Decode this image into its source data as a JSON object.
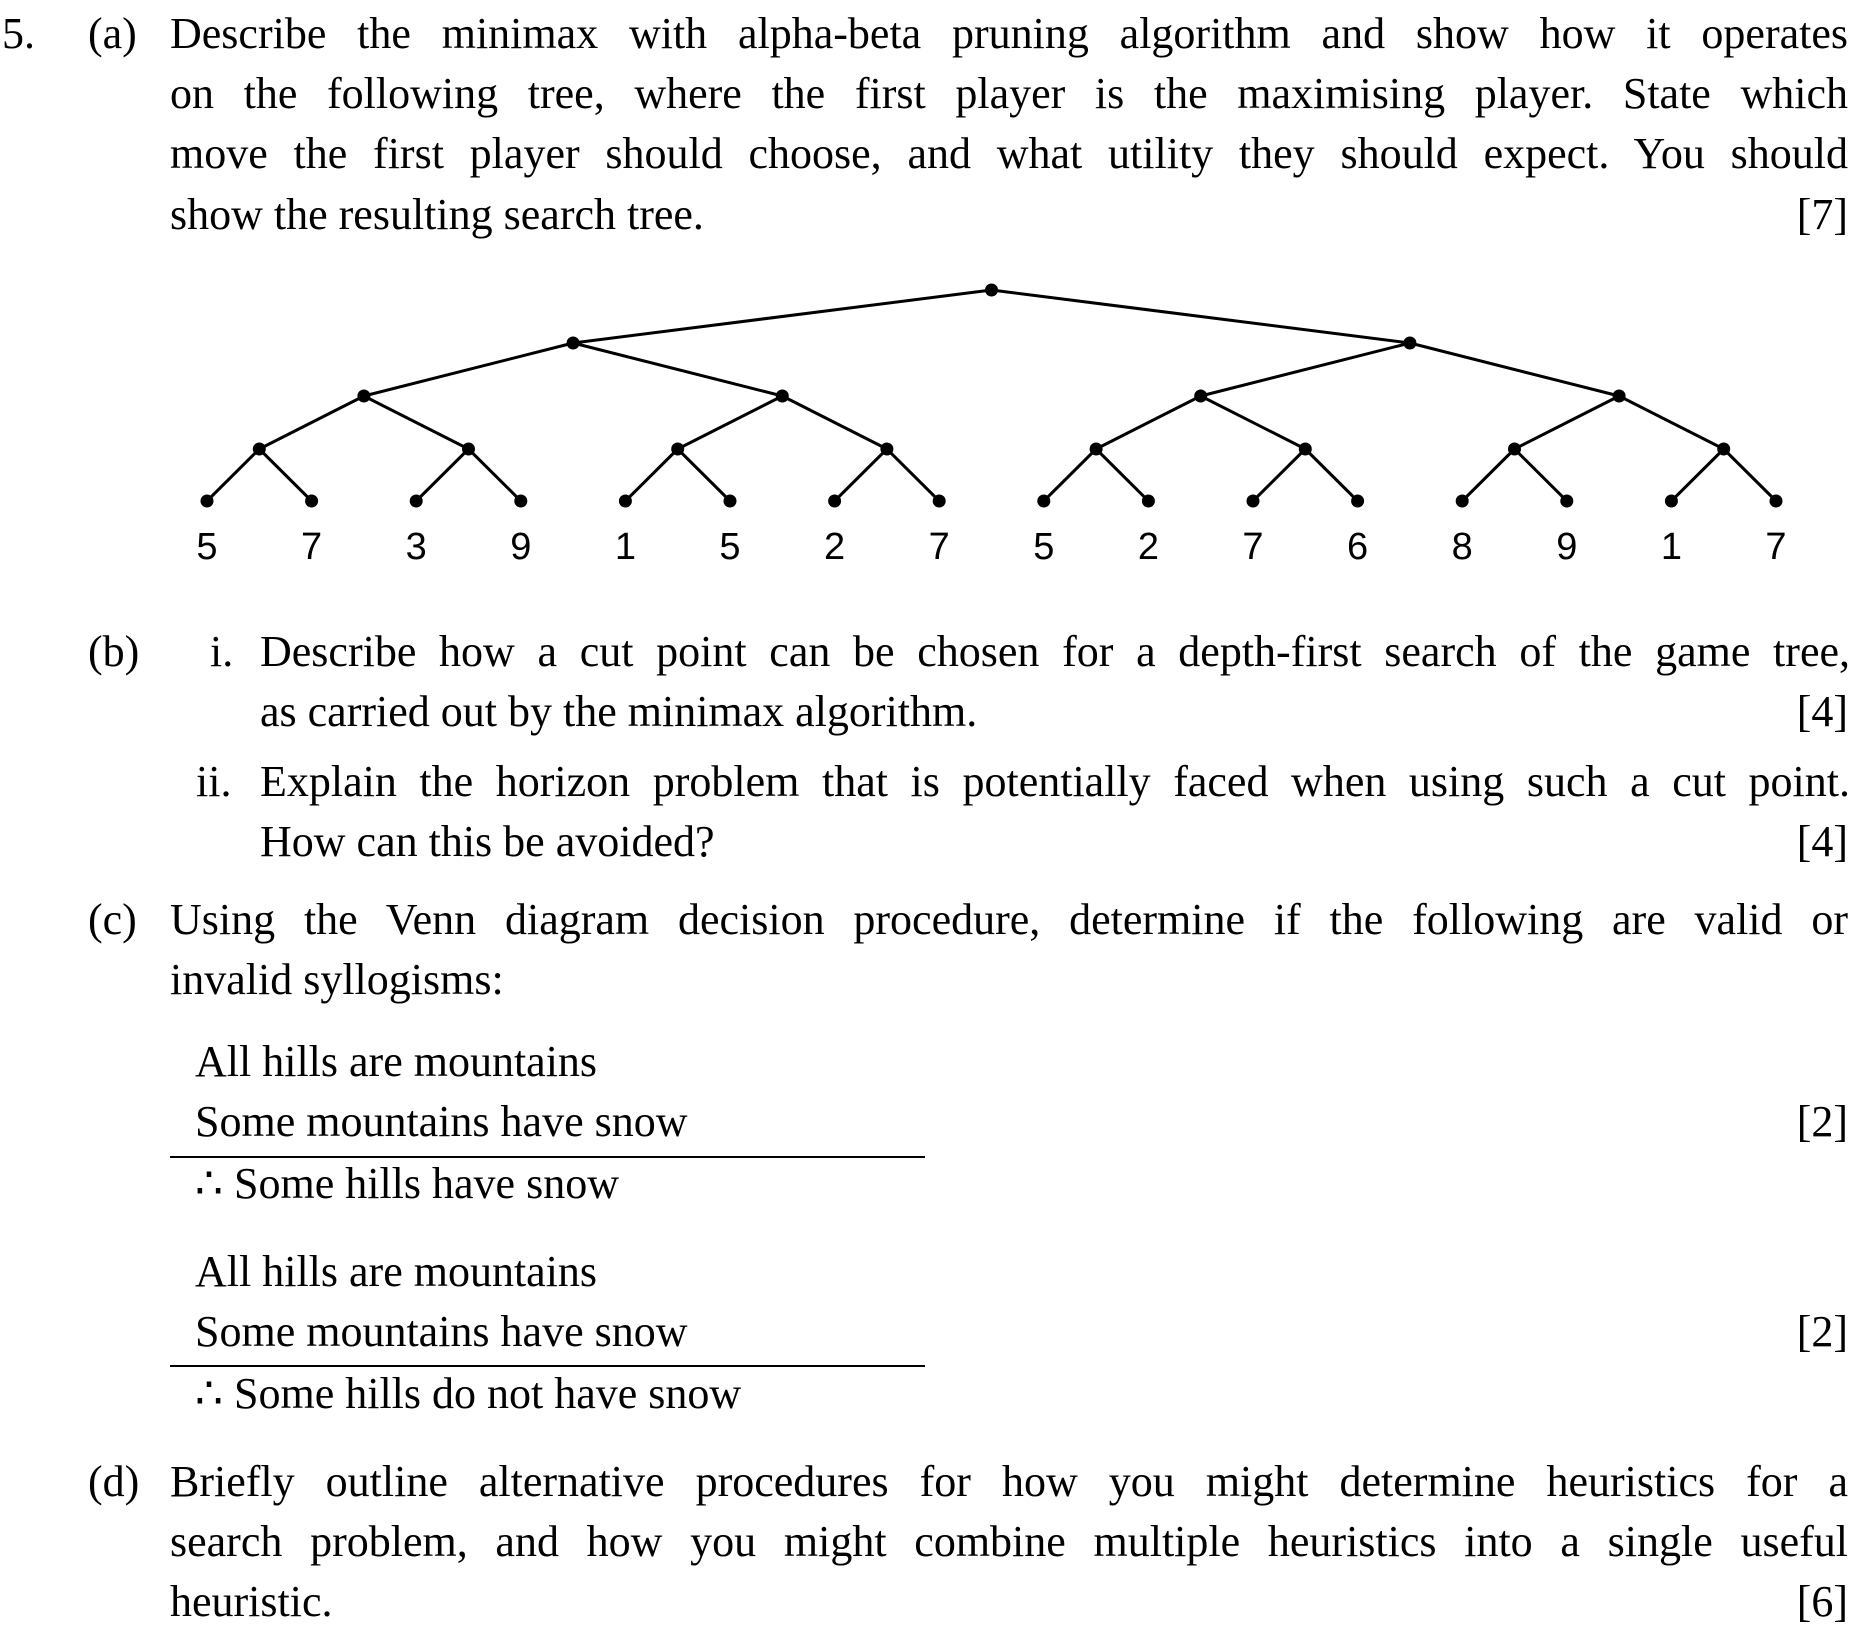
{
  "question": {
    "number": "5.",
    "part_a": {
      "label": "(a)",
      "lines": [
        "Describe the minimax with alpha-beta pruning algorithm and show how it operates",
        "on the following tree, where the first player is the maximising player.  State which",
        "move the first player should choose, and what utility they should expect. You should",
        "show the resulting search tree."
      ],
      "marks": "[7]"
    },
    "tree": {
      "leaves": [
        "5",
        "7",
        "3",
        "9",
        "1",
        "5",
        "2",
        "7",
        "5",
        "2",
        "7",
        "6",
        "8",
        "9",
        "1",
        "7"
      ]
    },
    "part_b": {
      "label": "(b)",
      "i": {
        "label": "i.",
        "lines": [
          "Describe how a cut point can be chosen for a depth-first search of the game tree,",
          "as carried out by the minimax algorithm."
        ],
        "marks": "[4]"
      },
      "ii": {
        "label": "ii.",
        "lines": [
          "Explain the horizon problem that is potentially faced when using such a cut point.",
          "How can this be avoided?"
        ],
        "marks": "[4]"
      }
    },
    "part_c": {
      "label": "(c)",
      "lines": [
        "Using the Venn diagram decision procedure, determine if the following are valid or",
        "invalid syllogisms:"
      ],
      "syllogism1": {
        "premise1": "All hills are mountains",
        "premise2": "Some mountains have snow",
        "conclusion": "∴ Some hills have snow",
        "marks": "[2]"
      },
      "syllogism2": {
        "premise1": "All hills are mountains",
        "premise2": "Some mountains have snow",
        "conclusion": "∴ Some hills do not have snow",
        "marks": "[2]"
      }
    },
    "part_d": {
      "label": "(d)",
      "lines": [
        "Briefly outline alternative procedures for how you might determine heuristics for a",
        "search problem, and how you might combine multiple heuristics into a single useful",
        "heuristic."
      ],
      "marks": "[6]"
    }
  }
}
